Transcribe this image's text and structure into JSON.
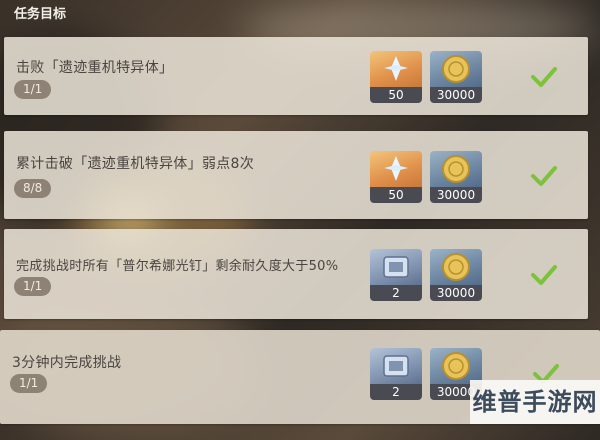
{
  "header": {
    "title": "任务目标"
  },
  "quests": [
    {
      "title": "击败「遗迹重机特异体」",
      "progress": "1/1",
      "rewards": [
        {
          "icon": "primogem-icon",
          "qty": "50"
        },
        {
          "icon": "mora-coin-icon",
          "qty": "30000"
        }
      ],
      "status": "completed"
    },
    {
      "title": "累计击破「遗迹重机特异体」弱点8次",
      "progress": "8/8",
      "rewards": [
        {
          "icon": "primogem-icon",
          "qty": "50"
        },
        {
          "icon": "mora-coin-icon",
          "qty": "30000"
        }
      ],
      "status": "completed"
    },
    {
      "title": "完成挑战时所有「普尔希娜光钉」剩余耐久度大于50%",
      "progress": "1/1",
      "rewards": [
        {
          "icon": "enhancement-ore-icon",
          "qty": "2"
        },
        {
          "icon": "mora-coin-icon",
          "qty": "30000"
        }
      ],
      "status": "completed"
    },
    {
      "title": "3分钟内完成挑战",
      "progress": "1/1",
      "rewards": [
        {
          "icon": "enhancement-ore-icon",
          "qty": "2"
        },
        {
          "icon": "mora-coin-icon",
          "qty": "30000"
        }
      ],
      "status": "completed"
    }
  ],
  "colors": {
    "check": "#7cc23a",
    "badge": "#8d8273",
    "panel": "#ece5d8"
  },
  "watermark": {
    "text": "维普手游网"
  }
}
